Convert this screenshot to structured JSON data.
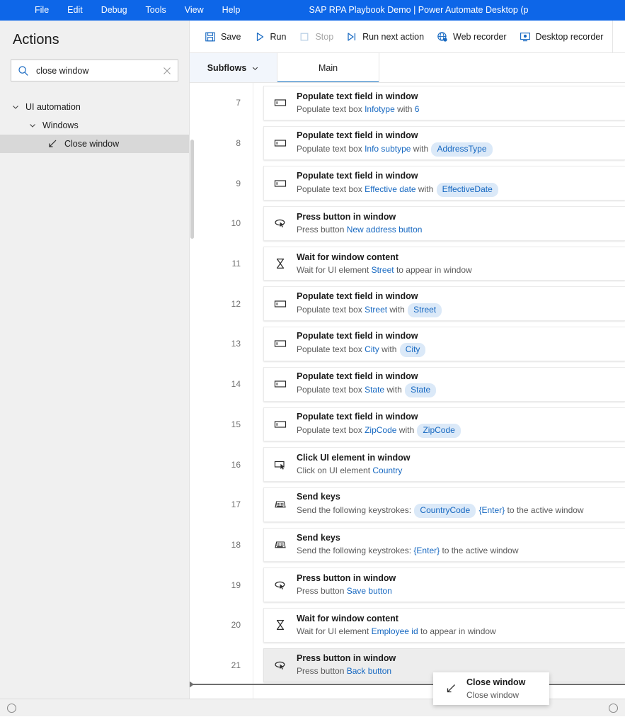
{
  "window": {
    "title": "SAP RPA Playbook Demo | Power Automate Desktop (p",
    "accent": "#0d66e8",
    "menu": [
      "File",
      "Edit",
      "Debug",
      "Tools",
      "View",
      "Help"
    ]
  },
  "sidebar": {
    "header": "Actions",
    "search": {
      "value": "close window",
      "placeholder": "Search actions",
      "icon": "search-icon",
      "clear_icon": "close-icon"
    },
    "tree": [
      {
        "label": "UI automation",
        "level": 0,
        "expanded": true,
        "selected": false,
        "icon": "chevron-down-icon"
      },
      {
        "label": "Windows",
        "level": 1,
        "expanded": true,
        "selected": false,
        "icon": "chevron-down-icon"
      },
      {
        "label": "Close window",
        "level": 2,
        "expanded": false,
        "selected": true,
        "icon": "close-window-icon"
      }
    ]
  },
  "toolbar": {
    "buttons": [
      {
        "label": "Save",
        "icon": "save-icon",
        "disabled": false
      },
      {
        "label": "Run",
        "icon": "run-icon",
        "disabled": false
      },
      {
        "label": "Stop",
        "icon": "stop-icon",
        "disabled": true
      },
      {
        "label": "Run next action",
        "icon": "run-next-action-icon",
        "disabled": false
      },
      {
        "label": "Web recorder",
        "icon": "web-recorder-icon",
        "disabled": false
      },
      {
        "label": "Desktop recorder",
        "icon": "desktop-recorder-icon",
        "disabled": false
      }
    ]
  },
  "tabs": {
    "subflows": {
      "label": "Subflows",
      "icon": "chevron-down-icon",
      "active": false
    },
    "main": {
      "label": "Main",
      "active": true
    }
  },
  "flow": {
    "rows": [
      {
        "num": "7",
        "icon": "populate-text-field-icon",
        "title": "Populate text field in window",
        "parts": [
          {
            "t": "plain",
            "v": "Populate text box "
          },
          {
            "t": "link",
            "v": "Infotype"
          },
          {
            "t": "plain",
            "v": " with "
          },
          {
            "t": "link",
            "v": "6"
          }
        ]
      },
      {
        "num": "8",
        "icon": "populate-text-field-icon",
        "title": "Populate text field in window",
        "parts": [
          {
            "t": "plain",
            "v": "Populate text box "
          },
          {
            "t": "link",
            "v": "Info subtype"
          },
          {
            "t": "plain",
            "v": " with "
          },
          {
            "t": "chip",
            "v": "AddressType"
          }
        ]
      },
      {
        "num": "9",
        "icon": "populate-text-field-icon",
        "title": "Populate text field in window",
        "parts": [
          {
            "t": "plain",
            "v": "Populate text box "
          },
          {
            "t": "link",
            "v": "Effective date"
          },
          {
            "t": "plain",
            "v": " with "
          },
          {
            "t": "chip",
            "v": "EffectiveDate"
          }
        ]
      },
      {
        "num": "10",
        "icon": "press-button-icon",
        "title": "Press button in window",
        "parts": [
          {
            "t": "plain",
            "v": "Press button "
          },
          {
            "t": "link",
            "v": "New address button"
          }
        ]
      },
      {
        "num": "11",
        "icon": "wait-icon",
        "title": "Wait for window content",
        "parts": [
          {
            "t": "plain",
            "v": "Wait for UI element "
          },
          {
            "t": "link",
            "v": "Street"
          },
          {
            "t": "plain",
            "v": " to appear in window"
          }
        ]
      },
      {
        "num": "12",
        "icon": "populate-text-field-icon",
        "title": "Populate text field in window",
        "parts": [
          {
            "t": "plain",
            "v": "Populate text box "
          },
          {
            "t": "link",
            "v": "Street"
          },
          {
            "t": "plain",
            "v": " with "
          },
          {
            "t": "chip",
            "v": "Street"
          }
        ]
      },
      {
        "num": "13",
        "icon": "populate-text-field-icon",
        "title": "Populate text field in window",
        "parts": [
          {
            "t": "plain",
            "v": "Populate text box "
          },
          {
            "t": "link",
            "v": "City"
          },
          {
            "t": "plain",
            "v": " with "
          },
          {
            "t": "chip",
            "v": "City"
          }
        ]
      },
      {
        "num": "14",
        "icon": "populate-text-field-icon",
        "title": "Populate text field in window",
        "parts": [
          {
            "t": "plain",
            "v": "Populate text box "
          },
          {
            "t": "link",
            "v": "State"
          },
          {
            "t": "plain",
            "v": " with "
          },
          {
            "t": "chip",
            "v": "State"
          }
        ]
      },
      {
        "num": "15",
        "icon": "populate-text-field-icon",
        "title": "Populate text field in window",
        "parts": [
          {
            "t": "plain",
            "v": "Populate text box "
          },
          {
            "t": "link",
            "v": "ZipCode"
          },
          {
            "t": "plain",
            "v": " with "
          },
          {
            "t": "chip",
            "v": "ZipCode"
          }
        ]
      },
      {
        "num": "16",
        "icon": "click-ui-element-icon",
        "title": "Click UI element in window",
        "parts": [
          {
            "t": "plain",
            "v": "Click on UI element "
          },
          {
            "t": "link",
            "v": "Country"
          }
        ]
      },
      {
        "num": "17",
        "icon": "send-keys-icon",
        "title": "Send keys",
        "parts": [
          {
            "t": "plain",
            "v": "Send the following keystrokes: "
          },
          {
            "t": "chip",
            "v": "CountryCode"
          },
          {
            "t": "plain",
            "v": " "
          },
          {
            "t": "link",
            "v": "{Enter}"
          },
          {
            "t": "plain",
            "v": " to the active window"
          }
        ]
      },
      {
        "num": "18",
        "icon": "send-keys-icon",
        "title": "Send keys",
        "parts": [
          {
            "t": "plain",
            "v": "Send the following keystrokes: "
          },
          {
            "t": "link",
            "v": "{Enter}"
          },
          {
            "t": "plain",
            "v": " to the active window"
          }
        ]
      },
      {
        "num": "19",
        "icon": "press-button-icon",
        "title": "Press button in window",
        "parts": [
          {
            "t": "plain",
            "v": "Press button "
          },
          {
            "t": "link",
            "v": "Save button"
          }
        ]
      },
      {
        "num": "20",
        "icon": "wait-icon",
        "title": "Wait for window content",
        "parts": [
          {
            "t": "plain",
            "v": "Wait for UI element "
          },
          {
            "t": "link",
            "v": "Employee id"
          },
          {
            "t": "plain",
            "v": " to appear in window"
          }
        ]
      },
      {
        "num": "21",
        "icon": "press-button-icon",
        "title": "Press button in window",
        "highlight": true,
        "parts": [
          {
            "t": "plain",
            "v": "Press button "
          },
          {
            "t": "link",
            "v": "Back button"
          }
        ]
      }
    ]
  },
  "drag_ghost": {
    "title": "Close window",
    "subtitle": "Close window",
    "icon": "close-window-icon"
  },
  "colors": {
    "accent_blue": "#0d66e8",
    "link_blue": "#1668c1",
    "chip_bg": "#dbe9f8",
    "tab_underline": "#0f6cbd",
    "selection_gray": "#d8d8d8"
  }
}
